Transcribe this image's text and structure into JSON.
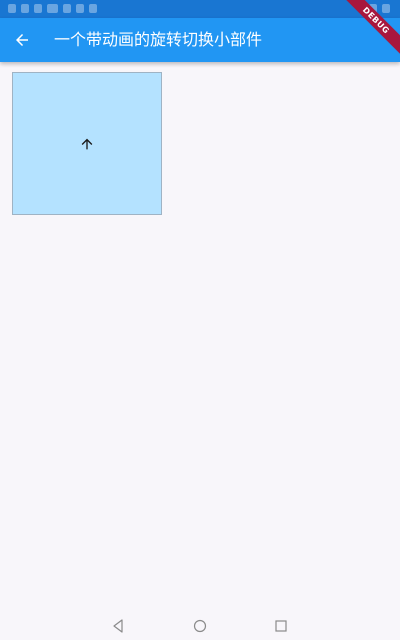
{
  "app_bar": {
    "title": "一个带动画的旋转切换小部件",
    "back_icon": "arrow-back-icon",
    "background": "#2196f3",
    "status_bar_background": "#1976d2"
  },
  "debug_banner": {
    "label": "DEBUG",
    "color": "#a8173d"
  },
  "content": {
    "switcher": {
      "icon": "arrow-upward-icon",
      "background": "#b4e2ff"
    }
  },
  "nav_bar": {
    "icons": [
      "nav-back-icon",
      "nav-home-icon",
      "nav-recents-icon"
    ]
  }
}
